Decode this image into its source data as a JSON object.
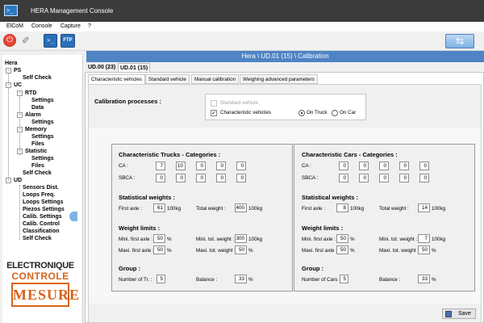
{
  "window": {
    "title": "HERA Management Console"
  },
  "menu": [
    "ElCoM",
    "Console",
    "Capture",
    "?"
  ],
  "toolbar": {
    "power_icon": "power-icon",
    "plug_icon": "connect-icon",
    "terminal_label": ">_",
    "ftp_label": "FTP",
    "refresh_icon": "refresh-icon"
  },
  "tree": {
    "root": "Hera",
    "items": [
      {
        "label": "PS"
      },
      {
        "label": "Self Check"
      },
      {
        "label": "UC"
      },
      {
        "label": "RTD"
      },
      {
        "label": "Settings"
      },
      {
        "label": "Data"
      },
      {
        "label": "Alarm"
      },
      {
        "label": "Settings"
      },
      {
        "label": "Memory"
      },
      {
        "label": "Settings"
      },
      {
        "label": "Files"
      },
      {
        "label": "Statistic"
      },
      {
        "label": "Settings"
      },
      {
        "label": "Files"
      },
      {
        "label": "Self Check"
      },
      {
        "label": "UD"
      },
      {
        "label": "Sensors Dist."
      },
      {
        "label": "Loops Freq."
      },
      {
        "label": "Loops Settings"
      },
      {
        "label": "Piezos Settings"
      },
      {
        "label": "Calib. Settings"
      },
      {
        "label": "Calib. Control"
      },
      {
        "label": "Classification"
      },
      {
        "label": "Self Check"
      }
    ]
  },
  "logo": {
    "line1": "ELECTRONIQUE",
    "line2": "CONTROLE",
    "line3": "MESURE"
  },
  "banner": {
    "text": "Hera \\ UD.01  (15)  \\ Calibration"
  },
  "ud_tabs": [
    "UD.00 (23)",
    "UD.01 (15)"
  ],
  "sub_tabs": [
    "Characteristic vehicles",
    "Standard vehicle",
    "Manual calibration",
    "Weighing advanced parameters"
  ],
  "calibration": {
    "label": "Calibration processes :",
    "standard_vehicle": "Standard vehicle",
    "characteristic_vehicles": "Characteristic vehicles",
    "on_truck": "On Truck",
    "on_car": "On Car"
  },
  "trucks": {
    "categories_title": "Characteristic Trucks - Categories :",
    "ca_label": "CA :",
    "ca_values": [
      "7",
      "10",
      "0",
      "0",
      "0"
    ],
    "sbca_label": "SBCA :",
    "sbca_values": [
      "0",
      "0",
      "0",
      "0",
      "0"
    ],
    "weights_title": "Statistical weights :",
    "first_axle_label": "First axle :",
    "first_axle": "61",
    "first_axle_unit": "100kg",
    "total_weight_label": "Total weight :",
    "total_weight": "400",
    "total_weight_unit": "100kg",
    "limits_title": "Weight limits :",
    "mini_first_axle_label": "Mini. first axle :",
    "mini_first_axle": "50",
    "mini_tot_weight_label": "Mini. tot. weight :",
    "mini_tot_weight": "300",
    "mini_tot_weight_unit": "100kg",
    "maxi_first_axle_label": "Maxi. first axle :",
    "maxi_first_axle": "50",
    "maxi_tot_weight_label": "Maxi. tot. weight :",
    "maxi_tot_weight": "50",
    "pct": "%",
    "group_title": "Group :",
    "number_label": "Number of Tr. :",
    "number": "5",
    "balance_label": "Balance :",
    "balance": "33"
  },
  "cars": {
    "categories_title": "Characteristic Cars - Categories :",
    "ca_label": "CA :",
    "ca_values": [
      "0",
      "0",
      "0",
      "0",
      "0"
    ],
    "sbca_label": "SBCA :",
    "sbca_values": [
      "0",
      "0",
      "0",
      "0",
      "0"
    ],
    "weights_title": "Statistical weights :",
    "first_axle_label": "First axle :",
    "first_axle": "8",
    "first_axle_unit": "100kg",
    "total_weight_label": "Total weight :",
    "total_weight": "14",
    "total_weight_unit": "100kg",
    "limits_title": "Weight limits :",
    "mini_first_axle_label": "Mini. first axle :",
    "mini_first_axle": "50",
    "mini_tot_weight_label": "Mini. tot. weight :",
    "mini_tot_weight": "7",
    "mini_tot_weight_unit": "100kg",
    "maxi_first_axle_label": "Maxi. first axle :",
    "maxi_first_axle": "50",
    "maxi_tot_weight_label": "Maxi. tot. weight :",
    "maxi_tot_weight": "50",
    "pct": "%",
    "group_title": "Group :",
    "number_label": "Number of Cars :",
    "number": "5",
    "balance_label": "Balance :",
    "balance": "33"
  },
  "save": {
    "label": "Save"
  }
}
